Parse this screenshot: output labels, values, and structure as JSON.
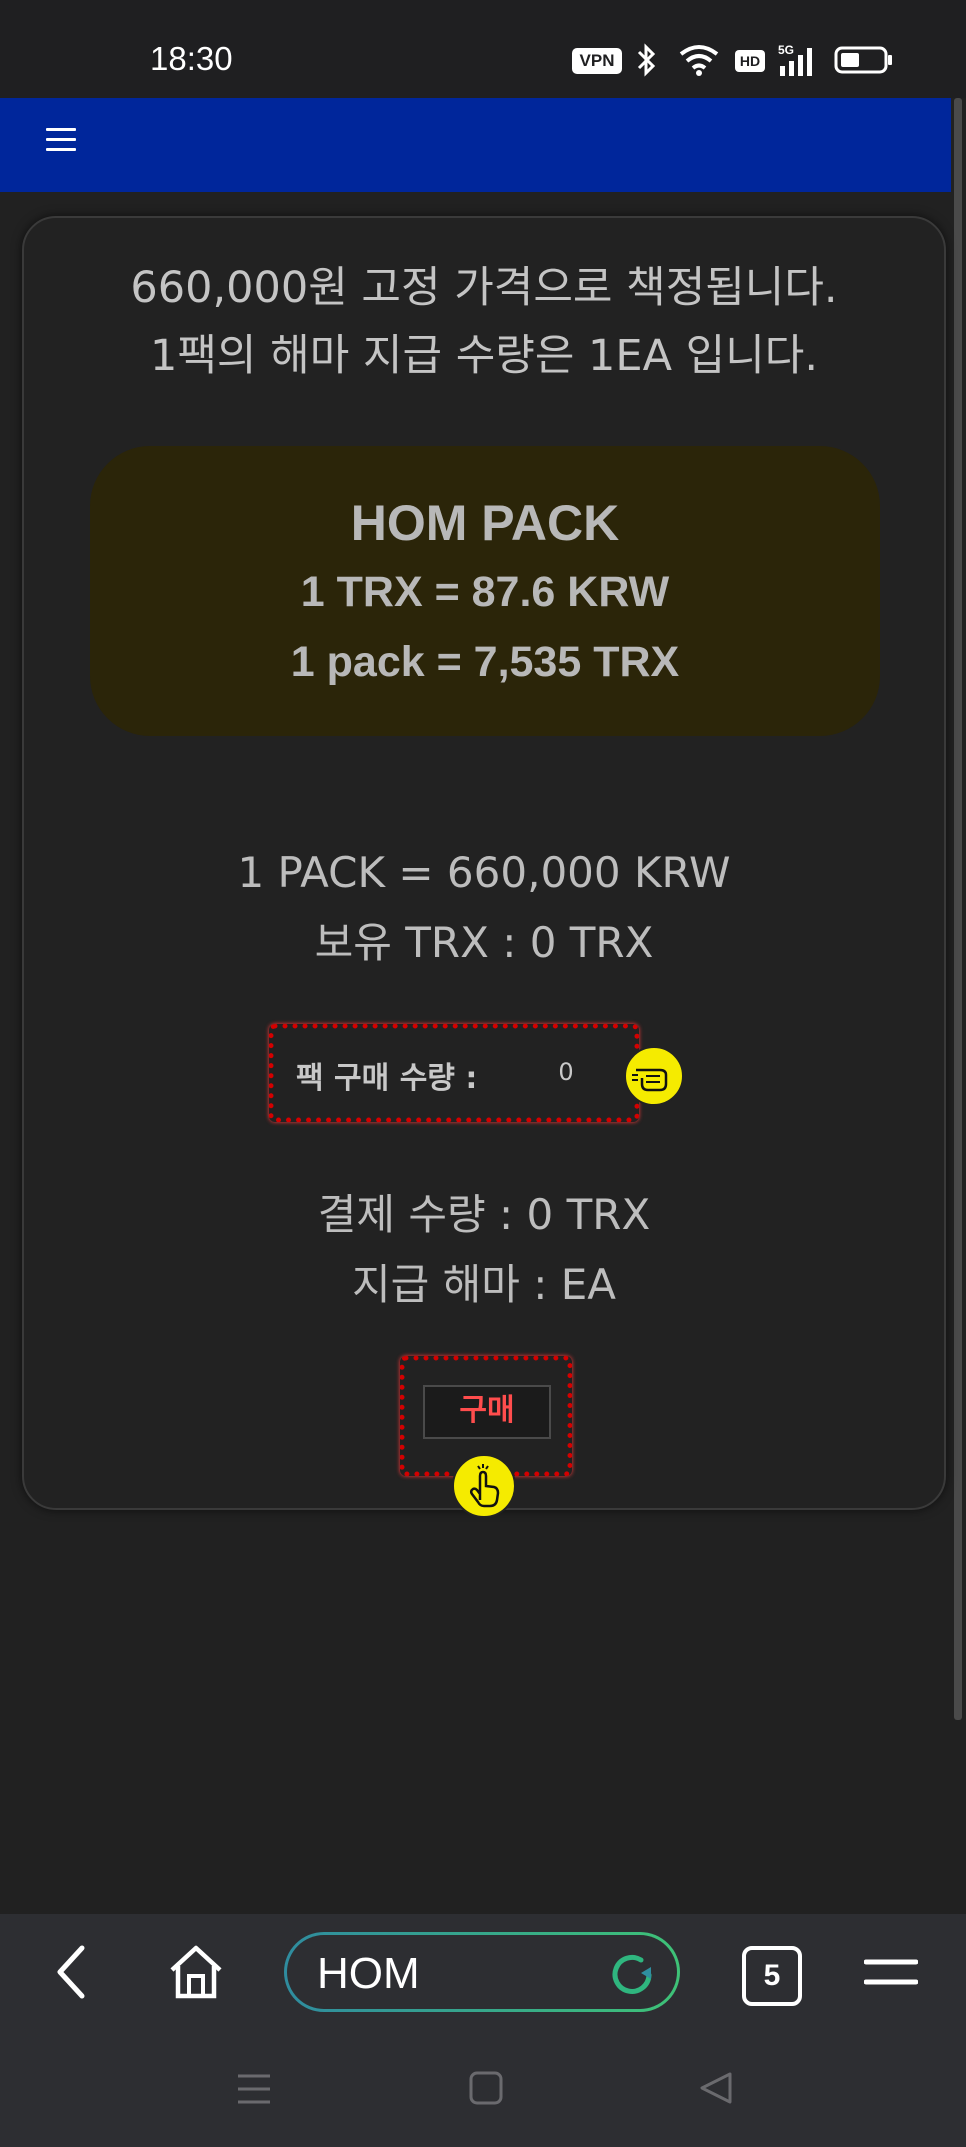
{
  "status_bar": {
    "time": "18:30",
    "vpn": "VPN",
    "hd": "HD",
    "network": "5G"
  },
  "header": {
    "menu_icon": "hamburger-menu-icon"
  },
  "card": {
    "intro_line1": "660,000원 고정 가격으로 책정됩니다.",
    "intro_line2": "1팩의 해마 지급 수량은 1EA 입니다.",
    "pack": {
      "title": "HOM PACK",
      "rate": "1 TRX = 87.6 KRW",
      "pack_price": "1 pack = 7,535 TRX"
    },
    "price_line": "1 PACK = 660,000 KRW",
    "balance_line": "보유 TRX : 0 TRX",
    "qty_label": "팩 구매 수량 :",
    "qty_value": "0",
    "payment_line": "결제 수량 : 0 TRX",
    "reward_line": "지급 해마 : EA",
    "buy_label": "구매"
  },
  "browser": {
    "url_text": "HOM",
    "tabs_count": "5"
  },
  "colors": {
    "nav_blue": "#00269b",
    "highlight_red": "#d40000",
    "hint_yellow": "#f5eb00",
    "pack_bg": "#2b2509"
  }
}
